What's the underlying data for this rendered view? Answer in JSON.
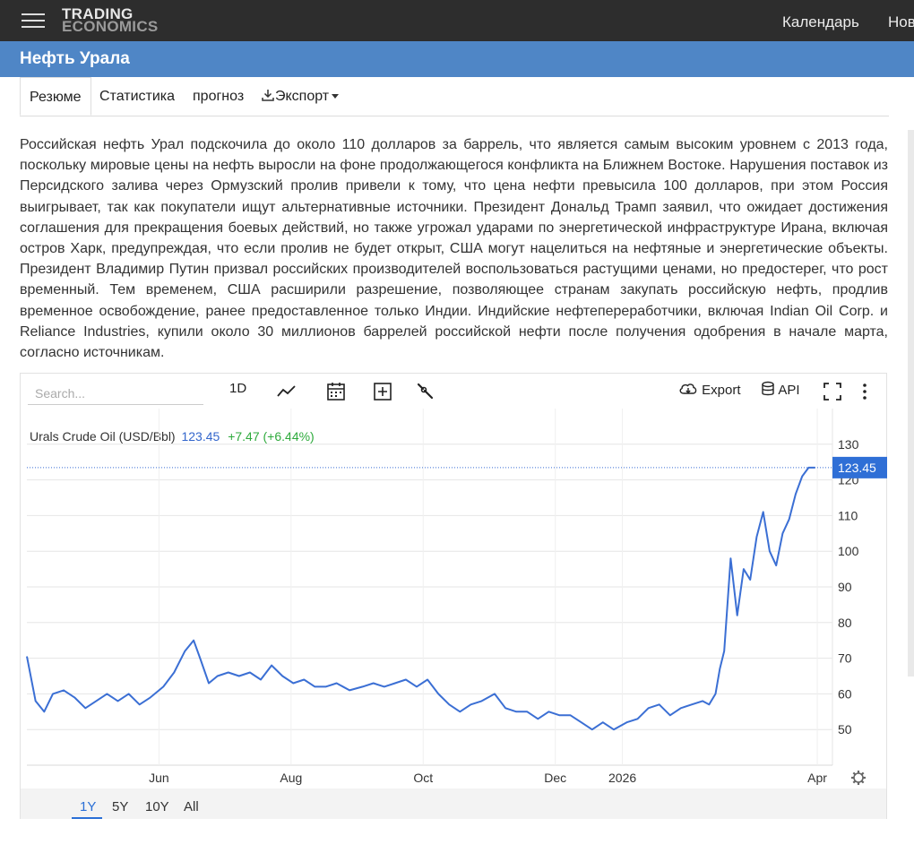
{
  "topbar": {
    "logo_line1": "TRADING",
    "logo_line2": "ECONOMICS",
    "nav": [
      "Календарь",
      "Нов"
    ]
  },
  "page": {
    "title": "Нефть Урала",
    "tabs": [
      "Резюме",
      "Статистика",
      "прогноз",
      "Экспорт"
    ],
    "description": "Российская нефть Урал подскочила до около 110 долларов за баррель, что является самым высоким уровнем с 2013 года, поскольку мировые цены на нефть выросли на фоне продолжающегося конфликта на Ближнем Востоке. Нарушения поставок из Персидского залива через Ормузский пролив привели к тому, что цена нефти превысила 100 долларов, при этом Россия выигрывает, так как покупатели ищут альтернативные источники. Президент Дональд Трамп заявил, что ожидает достижения соглашения для прекращения боевых действий, но также угрожал ударами по энергетической инфраструктуре Ирана, включая остров Харк, предупреждая, что если пролив не будет открыт, США могут нацелиться на нефтяные и энергетические объекты. Президент Владимир Путин призвал российских производителей воспользоваться растущими ценами, но предостерег, что рост временный. Тем временем, США расширили разрешение, позволяющее странам закупать российскую нефть, продлив временное освобождение, ранее предоставленное только Индии. Индийские нефтепереработчики, включая Indian Oil Corp. и Reliance Industries, купили около 30 миллионов баррелей российской нефти после получения одобрения в начале марта, согласно источникам."
  },
  "toolbar": {
    "search_placeholder": "Search...",
    "interval": "1D",
    "export_label": "Export",
    "api_label": "API",
    "icons": [
      "line-chart-icon",
      "calendar-icon",
      "compare-plus-icon",
      "wrench-icon",
      "cloud-download-icon",
      "database-icon",
      "fullscreen-icon",
      "more-vertical-icon"
    ]
  },
  "legend": {
    "name": "Urals Crude Oil (USD/Bbl)",
    "price": "123.45",
    "change": "+7.47 (+6.44%)"
  },
  "chart_data": {
    "type": "line",
    "series": [
      {
        "name": "Urals Crude Oil (USD/Bbl)",
        "color": "#3b6fd4",
        "x": [
          "2025-04-01",
          "2025-04-05",
          "2025-04-09",
          "2025-04-13",
          "2025-04-18",
          "2025-04-23",
          "2025-04-28",
          "2025-05-03",
          "2025-05-08",
          "2025-05-13",
          "2025-05-18",
          "2025-05-23",
          "2025-05-28",
          "2025-06-03",
          "2025-06-08",
          "2025-06-13",
          "2025-06-17",
          "2025-06-20",
          "2025-06-24",
          "2025-06-28",
          "2025-07-03",
          "2025-07-08",
          "2025-07-13",
          "2025-07-18",
          "2025-07-23",
          "2025-07-28",
          "2025-08-02",
          "2025-08-07",
          "2025-08-12",
          "2025-08-17",
          "2025-08-22",
          "2025-08-28",
          "2025-09-03",
          "2025-09-08",
          "2025-09-13",
          "2025-09-18",
          "2025-09-23",
          "2025-09-28",
          "2025-10-03",
          "2025-10-08",
          "2025-10-13",
          "2025-10-18",
          "2025-10-23",
          "2025-10-28",
          "2025-11-03",
          "2025-11-08",
          "2025-11-13",
          "2025-11-18",
          "2025-11-23",
          "2025-11-28",
          "2025-12-03",
          "2025-12-08",
          "2025-12-13",
          "2025-12-18",
          "2025-12-23",
          "2025-12-28",
          "2026-01-03",
          "2026-01-08",
          "2026-01-13",
          "2026-01-18",
          "2026-01-23",
          "2026-01-28",
          "2026-02-02",
          "2026-02-07",
          "2026-02-10",
          "2026-02-13",
          "2026-02-15",
          "2026-02-17",
          "2026-02-20",
          "2026-02-23",
          "2026-02-26",
          "2026-03-01",
          "2026-03-04",
          "2026-03-07",
          "2026-03-10",
          "2026-03-13",
          "2026-03-16",
          "2026-03-19",
          "2026-03-22",
          "2026-03-25",
          "2026-03-28",
          "2026-03-31"
        ],
        "y": [
          70.5,
          58,
          55,
          60,
          61,
          59,
          56,
          58,
          60,
          58,
          60,
          57,
          59,
          62,
          66,
          72,
          75,
          70,
          63,
          65,
          66,
          65,
          66,
          64,
          68,
          65,
          63,
          64,
          62,
          62,
          63,
          61,
          62,
          63,
          62,
          63,
          64,
          62,
          64,
          60,
          57,
          55,
          57,
          58,
          60,
          56,
          55,
          55,
          53,
          55,
          54,
          54,
          52,
          50,
          52,
          50,
          52,
          53,
          56,
          57,
          54,
          56,
          57,
          58,
          57,
          60,
          67,
          72,
          98,
          82,
          95,
          92,
          104,
          111,
          100,
          96,
          105,
          109,
          116,
          121,
          123.45,
          123.45
        ]
      }
    ],
    "x_ticks": [
      "Jun",
      "Aug",
      "Oct",
      "Dec",
      "2026",
      "Apr"
    ],
    "y_ticks": [
      50,
      60,
      70,
      80,
      90,
      100,
      110,
      120,
      130
    ],
    "ylim": [
      40,
      140
    ],
    "last_value_label": "123.45",
    "grid": true,
    "ranges": [
      "1Y",
      "5Y",
      "10Y",
      "All"
    ],
    "active_range": "1Y"
  }
}
